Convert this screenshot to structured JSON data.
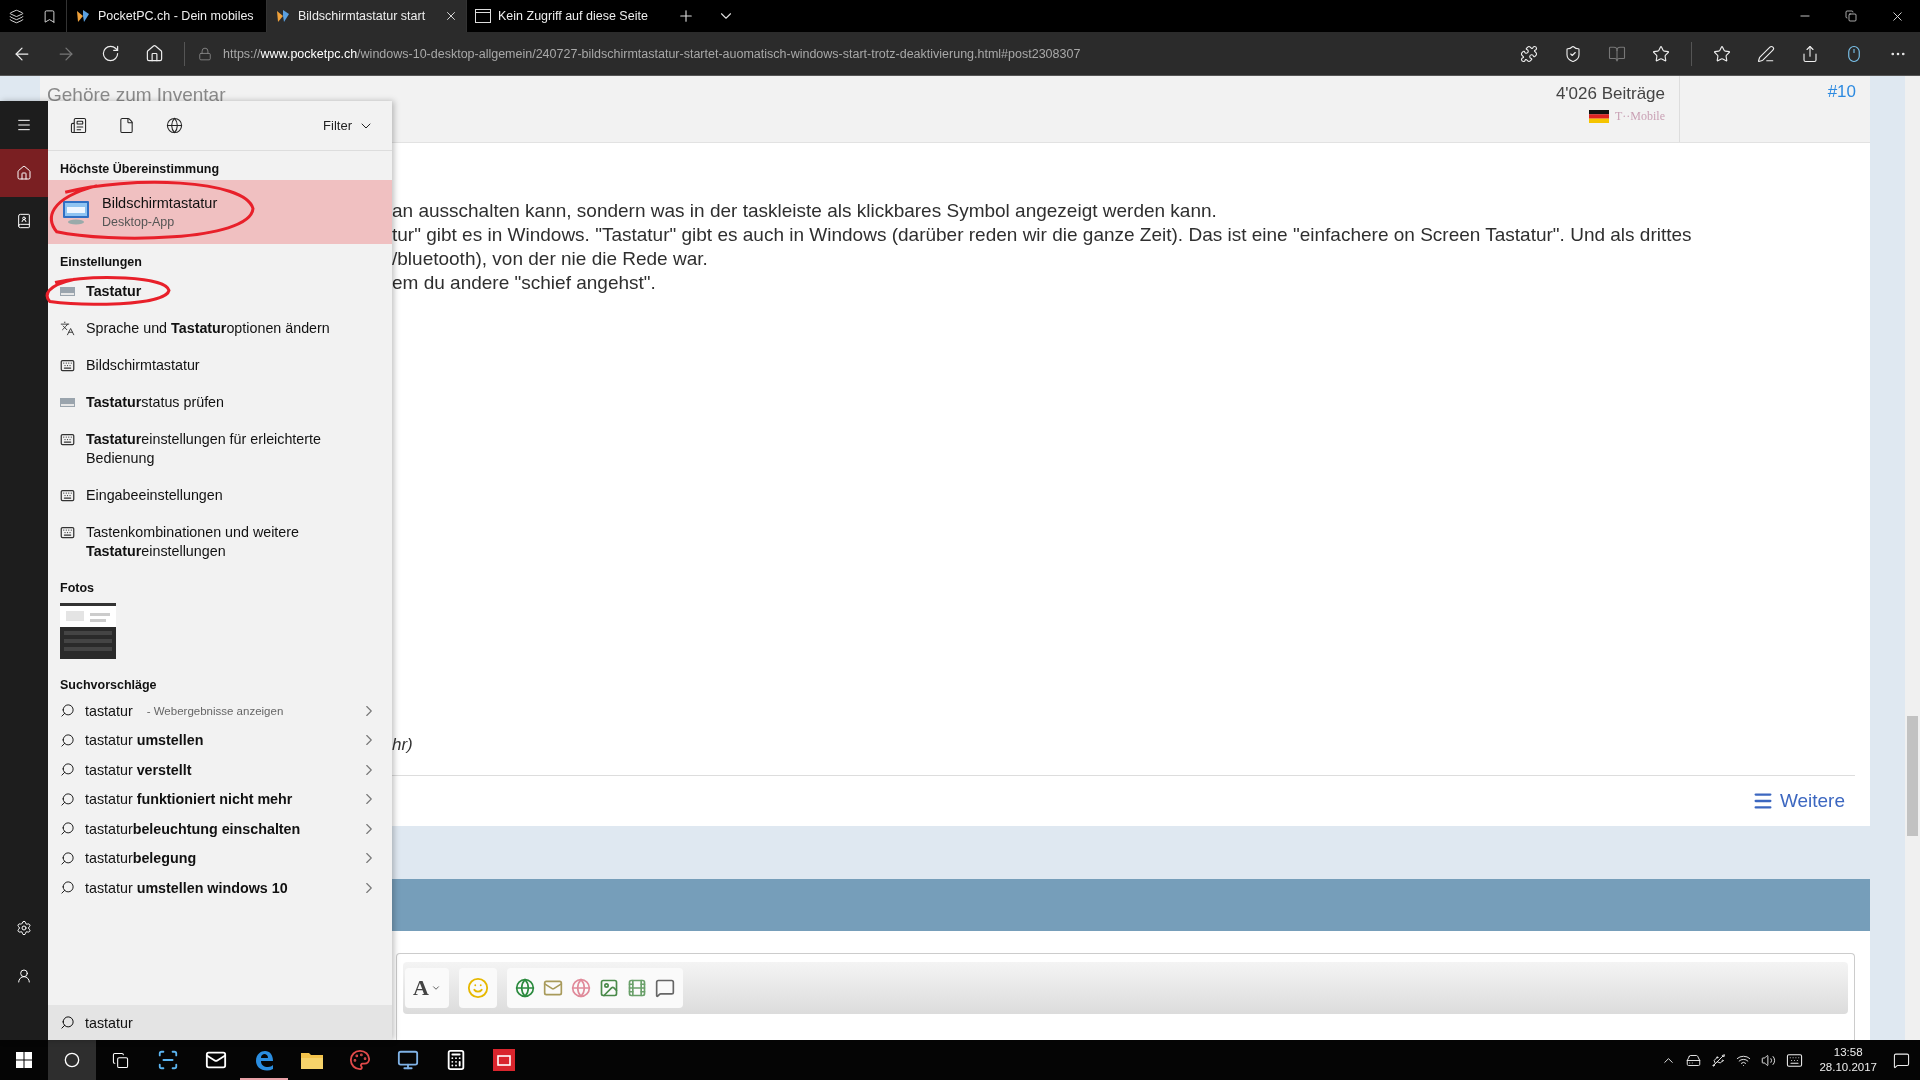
{
  "browser": {
    "tabs": [
      {
        "kind": "site",
        "title": "PocketPC.ch - Dein mobiles",
        "selected": false
      },
      {
        "kind": "site",
        "title": "Bildschirmtastatur start",
        "selected": true
      },
      {
        "kind": "page",
        "title": "Kein Zugriff auf diese Seite",
        "selected": false
      }
    ],
    "address": {
      "scheme": "https://",
      "host": "www.pocketpc.ch",
      "path": "/windows-10-desktop-allgemein/240727-bildschirmtastatur-startet-auomatisch-windows-start-trotz-deaktivierung.html#post2308307"
    }
  },
  "post": {
    "header_title": "Gehöre zum Inventar",
    "posts": "4'026 Beiträge",
    "carrier": "T··Mobile",
    "number": "#10",
    "lines": [
      "an ausschalten kann, sondern was in der taskleiste als klickbares Symbol angezeigt werden kann.",
      "tur\" gibt es in Windows. \"Tastatur\" gibt es auch in Windows (darüber reden wir die ganze Zeit). Das ist eine \"einfachere on Screen Tastatur\". Und als drittes",
      "/bluetooth), von der nie die Rede war.",
      "em du andere \"schief angehst\"."
    ],
    "tail": "hr)",
    "more_link": "Weitere"
  },
  "editor": {
    "font_button": "A"
  },
  "search_panel": {
    "nav": [
      {
        "kind": "menu",
        "selected": false
      },
      {
        "kind": "home",
        "selected": true
      },
      {
        "kind": "notebook",
        "selected": false
      },
      {
        "kind": "settings",
        "selected": false
      },
      {
        "kind": "feedback",
        "selected": false
      }
    ],
    "filters": [
      {
        "kind": "apps"
      },
      {
        "kind": "documents"
      },
      {
        "kind": "web"
      }
    ],
    "filter_label": "Filter",
    "best_match": {
      "heading": "Höchste Übereinstimmung",
      "title": "Bildschirmtastatur",
      "subtitle": "Desktop-App",
      "selected": true,
      "annotated": true
    },
    "settings": {
      "heading": "Einstellungen",
      "items": [
        {
          "kind": "hardware-keyboard",
          "text": "**Tastatur**",
          "annotated": true
        },
        {
          "kind": "language",
          "text": "Sprache und **Tastatur**optionen ändern",
          "annotated": false
        },
        {
          "kind": "keyboard",
          "text": "Bildschirmtastatur",
          "annotated": false
        },
        {
          "kind": "hardware-keyboard",
          "text": "**Tastatur**status prüfen",
          "annotated": false
        },
        {
          "kind": "keyboard",
          "text": "**Tastatur**einstellungen für erleichterte Bedienung",
          "annotated": false
        },
        {
          "kind": "keyboard",
          "text": "Eingabeeinstellungen",
          "annotated": false
        },
        {
          "kind": "keyboard",
          "text": "Tastenkombinationen und weitere **Tastatur**einstellungen",
          "annotated": false
        }
      ]
    },
    "photos": {
      "heading": "Fotos"
    },
    "suggestions": {
      "heading": "Suchvorschläge",
      "items": [
        {
          "text": "tastatur",
          "note": "- Webergebnisse anzeigen"
        },
        {
          "text": "tastatur **umstellen**"
        },
        {
          "text": "tastatur **verstellt**"
        },
        {
          "text": "tastatur **funktioniert nicht mehr**"
        },
        {
          "text": "tastatur**beleuchtung einschalten**"
        },
        {
          "text": "tastatur**belegung**"
        },
        {
          "text": "tastatur **umstellen windows 10**"
        }
      ]
    },
    "search": {
      "value": "tastatur"
    }
  },
  "taskbar": {
    "buttons": [
      {
        "kind": "start",
        "active": false
      },
      {
        "kind": "search",
        "active": true
      },
      {
        "kind": "task-view",
        "active": false
      }
    ],
    "apps": [
      {
        "kind": "scanner",
        "running": false
      },
      {
        "kind": "mail",
        "running": false
      },
      {
        "kind": "edge",
        "running": true
      },
      {
        "kind": "explorer",
        "running": false
      },
      {
        "kind": "paint",
        "running": false
      },
      {
        "kind": "network",
        "running": false
      },
      {
        "kind": "calculator",
        "running": false
      },
      {
        "kind": "red-app",
        "running": false
      }
    ],
    "clock": {
      "time": "13:58",
      "date": "28.10.2017"
    }
  }
}
